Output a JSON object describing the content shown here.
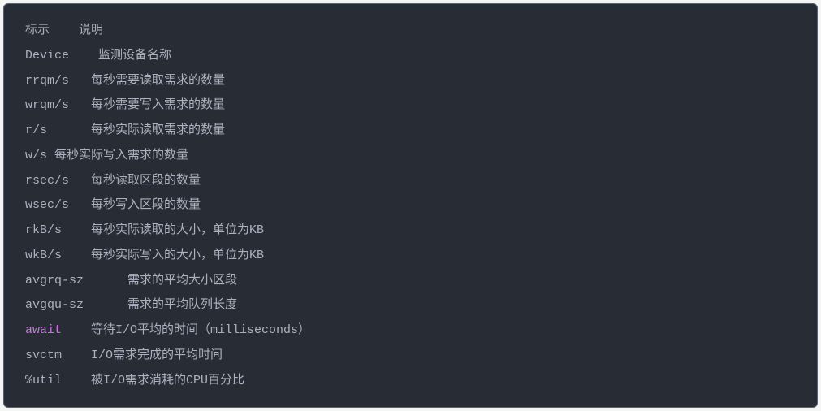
{
  "lines": [
    {
      "text": "标示    说明",
      "keyword": null
    },
    {
      "text": "Device    监测设备名称",
      "keyword": null
    },
    {
      "text": "rrqm/s   每秒需要读取需求的数量",
      "keyword": null
    },
    {
      "text": "wrqm/s   每秒需要写入需求的数量",
      "keyword": null
    },
    {
      "text": "r/s      每秒实际读取需求的数量",
      "keyword": null
    },
    {
      "text": "w/s 每秒实际写入需求的数量",
      "keyword": null
    },
    {
      "text": "rsec/s   每秒读取区段的数量",
      "keyword": null
    },
    {
      "text": "wsec/s   每秒写入区段的数量",
      "keyword": null
    },
    {
      "text": "rkB/s    每秒实际读取的大小，单位为KB",
      "keyword": null
    },
    {
      "text": "wkB/s    每秒实际写入的大小，单位为KB",
      "keyword": null
    },
    {
      "text": "avgrq-sz      需求的平均大小区段",
      "keyword": null
    },
    {
      "text": "avgqu-sz      需求的平均队列长度",
      "keyword": null
    },
    {
      "text": "    等待I/O平均的时间（milliseconds）",
      "keyword": "await"
    },
    {
      "text": "svctm    I/O需求完成的平均时间",
      "keyword": null
    },
    {
      "text": "%util    被I/O需求消耗的CPU百分比",
      "keyword": null
    }
  ]
}
